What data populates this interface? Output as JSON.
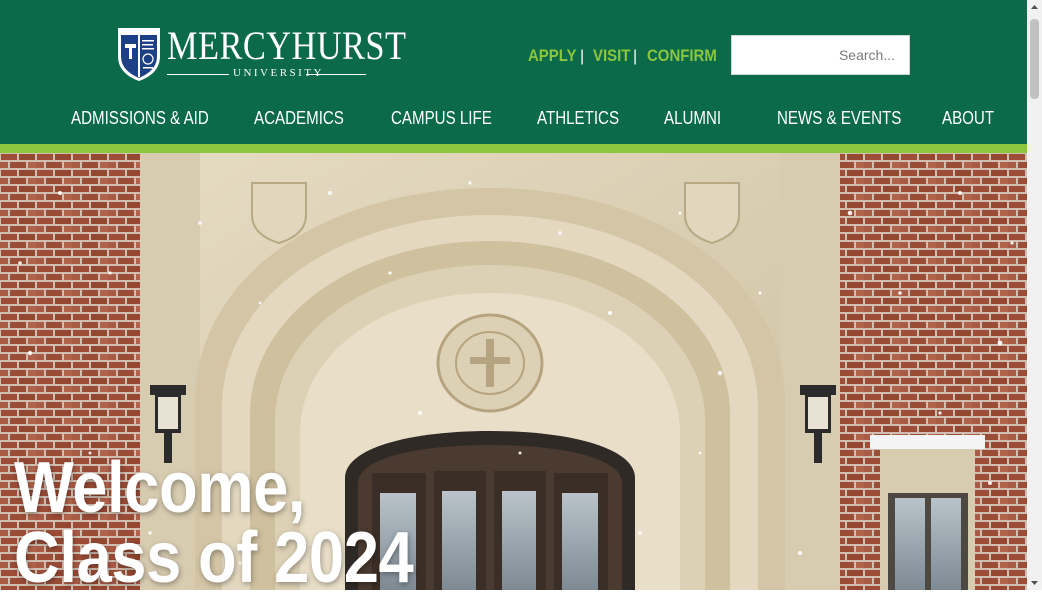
{
  "header": {
    "logo": {
      "name": "MERCYHURST",
      "sub": "UNIVERSITY"
    },
    "quick_links": [
      {
        "label": "APPLY"
      },
      {
        "label": "VISIT"
      },
      {
        "label": "CONFIRM"
      }
    ],
    "separator": "|",
    "search": {
      "placeholder": "Search...",
      "value": ""
    },
    "nav": [
      {
        "label": "ADMISSIONS & AID"
      },
      {
        "label": "ACADEMICS"
      },
      {
        "label": "CAMPUS LIFE"
      },
      {
        "label": "ATHLETICS"
      },
      {
        "label": "ALUMNI"
      },
      {
        "label": "NEWS & EVENTS"
      },
      {
        "label": "ABOUT"
      }
    ]
  },
  "hero": {
    "title_line1": "Welcome,",
    "title_line2": "Class of 2024",
    "image": "snowy-arched-doorway-photo"
  },
  "colors": {
    "header_bg": "#0b6a4a",
    "accent_green": "#8cc63f",
    "nav_text": "#ffffff"
  },
  "icons": {
    "crest": "university-crest-icon",
    "scroll_up": "scroll-up-arrow-icon",
    "scroll_down": "scroll-down-arrow-icon"
  }
}
